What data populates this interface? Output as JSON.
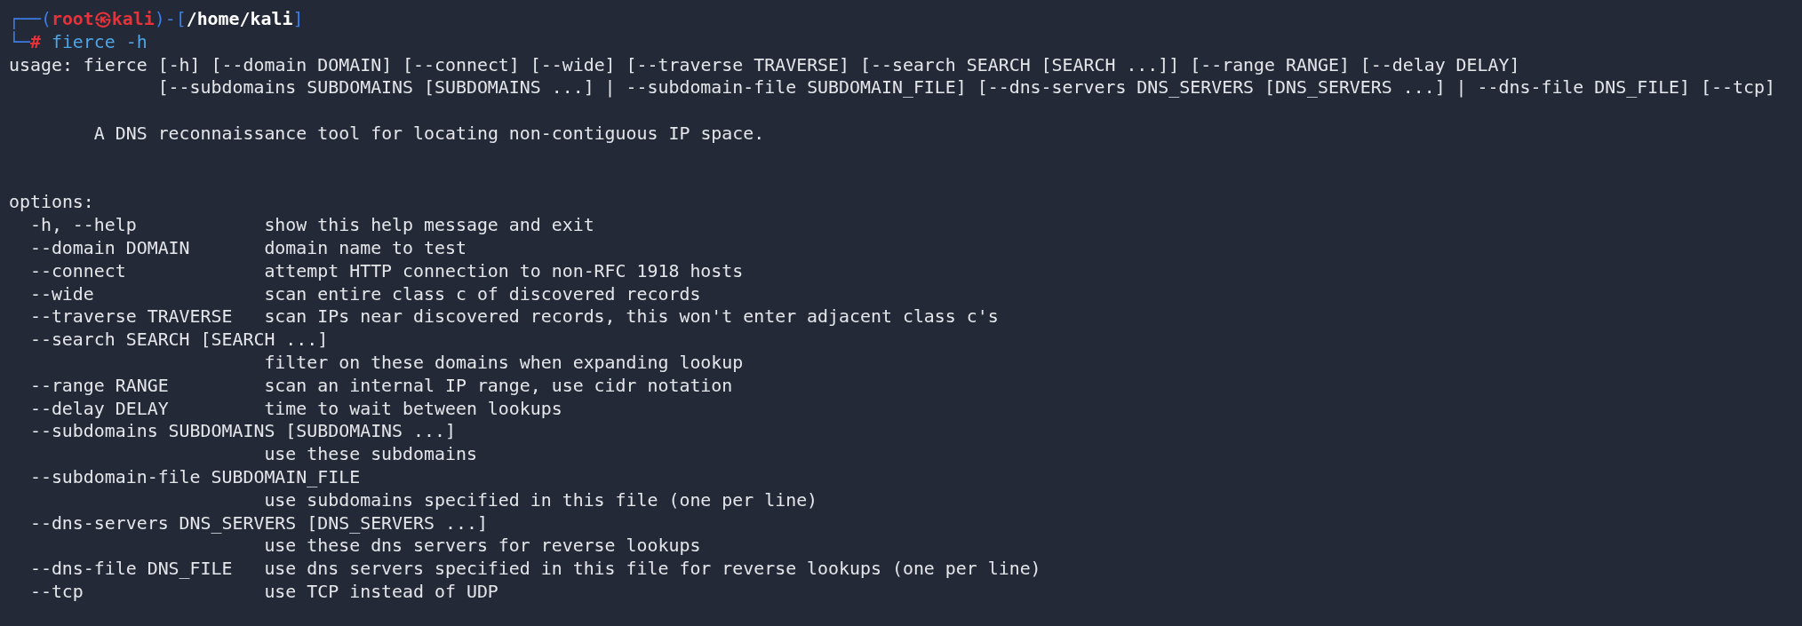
{
  "prompt": {
    "frame_top": "┌──(",
    "user_host": "root㉿kali",
    "separator": ")-[",
    "path": "/home/kali",
    "path_end": "]",
    "frame_bottom": "└─",
    "symbol": "#",
    "command": "fierce -h"
  },
  "usage": [
    "usage: fierce [-h] [--domain DOMAIN] [--connect] [--wide] [--traverse TRAVERSE] [--search SEARCH [SEARCH ...]] [--range RANGE] [--delay DELAY]",
    "[--subdomains SUBDOMAINS [SUBDOMAINS ...] | --subdomain-file SUBDOMAIN_FILE] [--dns-servers DNS_SERVERS [DNS_SERVERS ...] | --dns-file DNS_FILE] [--tcp]"
  ],
  "description": "A DNS reconnaissance tool for locating non-contiguous IP space.",
  "options_heading": "options:",
  "options": [
    {
      "flag": "-h, --help",
      "help": "show this help message and exit"
    },
    {
      "flag": "--domain DOMAIN",
      "help": "domain name to test"
    },
    {
      "flag": "--connect",
      "help": "attempt HTTP connection to non-RFC 1918 hosts"
    },
    {
      "flag": "--wide",
      "help": "scan entire class c of discovered records"
    },
    {
      "flag": "--traverse TRAVERSE",
      "help": "scan IPs near discovered records, this won't enter adjacent class c's"
    },
    {
      "flag": "--search SEARCH [SEARCH ...]",
      "help": "filter on these domains when expanding lookup"
    },
    {
      "flag": "--range RANGE",
      "help": "scan an internal IP range, use cidr notation"
    },
    {
      "flag": "--delay DELAY",
      "help": "time to wait between lookups"
    },
    {
      "flag": "--subdomains SUBDOMAINS [SUBDOMAINS ...]",
      "help": "use these subdomains"
    },
    {
      "flag": "--subdomain-file SUBDOMAIN_FILE",
      "help": "use subdomains specified in this file (one per line)"
    },
    {
      "flag": "--dns-servers DNS_SERVERS [DNS_SERVERS ...]",
      "help": "use these dns servers for reverse lookups"
    },
    {
      "flag": "--dns-file DNS_FILE",
      "help": "use dns servers specified in this file for reverse lookups (one per line)"
    },
    {
      "flag": "--tcp",
      "help": "use TCP instead of UDP"
    }
  ]
}
